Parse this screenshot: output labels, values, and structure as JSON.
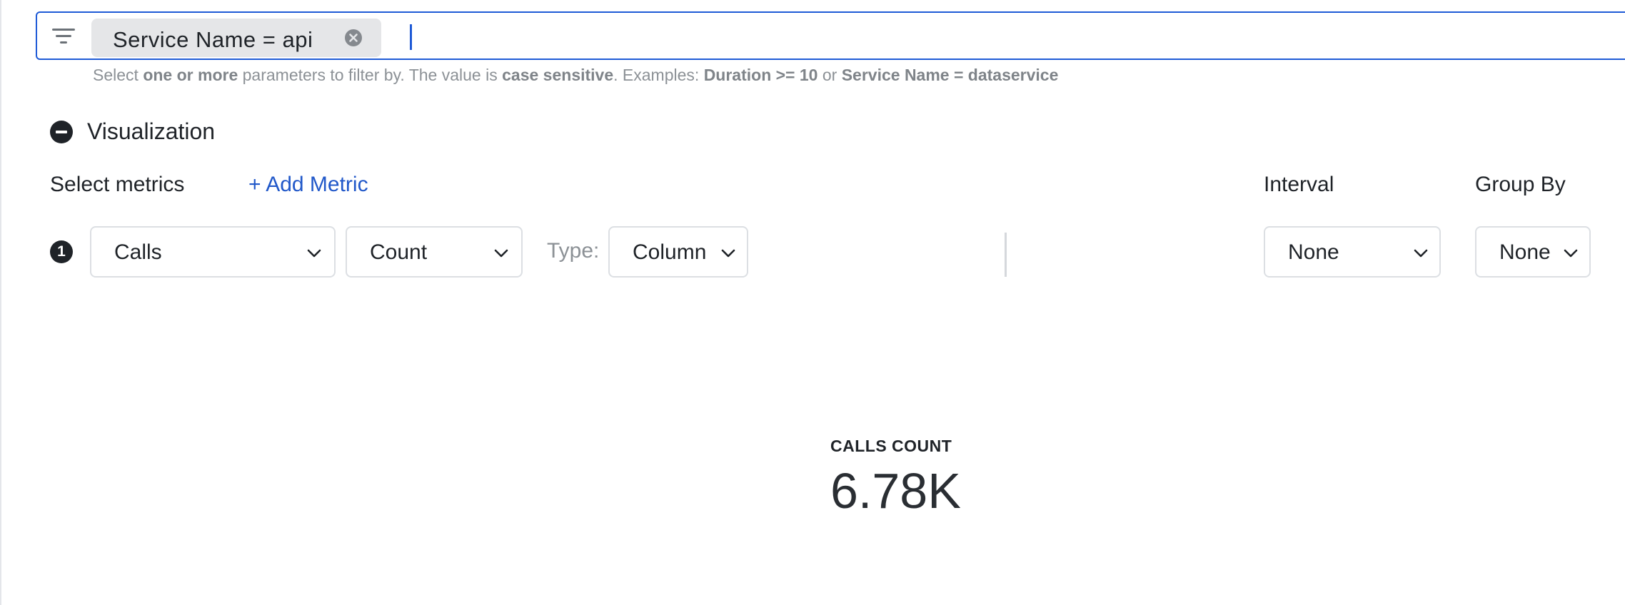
{
  "filter": {
    "chip_label": "Service Name = api",
    "input_value": "",
    "hint": {
      "p1": "Select ",
      "b1": "one or more",
      "p2": " parameters to filter by. The value is ",
      "b2": "case sensitive",
      "p3": ". Examples: ",
      "b3": "Duration >= 10",
      "p4": " or ",
      "b4": "Service Name = dataservice"
    }
  },
  "visualization": {
    "title": "Visualization",
    "select_metrics_label": "Select metrics",
    "add_metric_label": "+ Add Metric",
    "interval_label": "Interval",
    "group_by_label": "Group By",
    "metrics": [
      {
        "index": "1",
        "metric": "Calls",
        "aggregation": "Count",
        "type_label": "Type:",
        "type": "Column"
      }
    ],
    "interval_value": "None",
    "group_by_value": "None"
  },
  "stat": {
    "label": "CALLS COUNT",
    "value": "6.78K"
  },
  "icons": {
    "filter": "filter-lines-icon",
    "chip_remove": "close-circle-icon",
    "collapse": "minus-circle-icon",
    "dropdown": "chevron-down-icon"
  },
  "colors": {
    "accent": "#1e5ad6",
    "link": "#2158c9",
    "text": "#1f2328",
    "muted": "#8c9196"
  }
}
